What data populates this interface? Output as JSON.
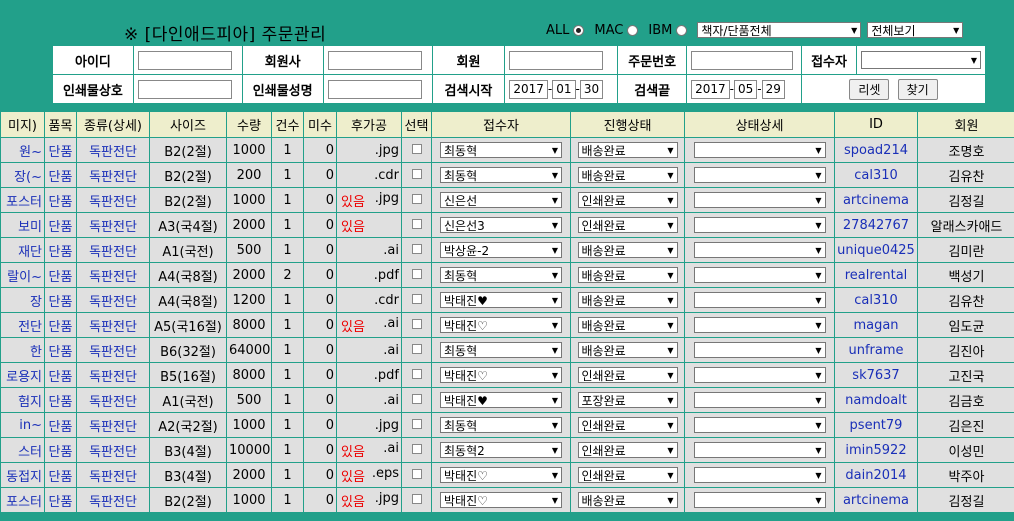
{
  "header": {
    "title": "※ [다인애드피아] 주문관리",
    "radios": [
      {
        "label": "ALL",
        "checked": true
      },
      {
        "label": "MAC",
        "checked": false
      },
      {
        "label": "IBM",
        "checked": false
      }
    ],
    "category_select": "책자/단품전체",
    "view_select": "전체보기"
  },
  "search": {
    "id_label": "아이디",
    "company_label": "회원사",
    "member_label": "회원",
    "order_no_label": "주문번호",
    "receiver_label": "접수자",
    "print_name_label": "인쇄물상호",
    "print_title_label": "인쇄물성명",
    "start_label": "검색시작",
    "end_label": "검색끝",
    "start_year": "2017",
    "start_month": "01",
    "start_day": "30",
    "end_year": "2017",
    "end_month": "05",
    "end_day": "29",
    "reset_label": "리셋",
    "find_label": "찾기"
  },
  "grid": {
    "columns": [
      "미지)",
      "품목",
      "종류(상세)",
      "사이즈",
      "수량",
      "건수",
      "미수",
      "후가공",
      "선택",
      "접수자",
      "진행상태",
      "상태상세",
      "ID",
      "회원"
    ],
    "rows": [
      {
        "name": "원~",
        "item": "단품",
        "kind": "독판전단",
        "size": "B2(2절)",
        "qty": "1000",
        "count": "1",
        "unpaid": "0",
        "post": "",
        "ext": ".jpg",
        "receiver": "최동혁",
        "status": "배송완료",
        "id": "spoad214",
        "member": "조명호"
      },
      {
        "name": "장(~",
        "item": "단품",
        "kind": "독판전단",
        "size": "B2(2절)",
        "qty": "200",
        "count": "1",
        "unpaid": "0",
        "post": "",
        "ext": ".cdr",
        "receiver": "최동혁",
        "status": "배송완료",
        "id": "cal310",
        "member": "김유찬"
      },
      {
        "name": "포스터",
        "item": "단품",
        "kind": "독판전단",
        "size": "B2(2절)",
        "qty": "1000",
        "count": "1",
        "unpaid": "0",
        "post": "있음",
        "ext": ".jpg",
        "receiver": "신은선",
        "status": "인쇄완료",
        "id": "artcinema",
        "member": "김정길"
      },
      {
        "name": "보미",
        "item": "단품",
        "kind": "독판전단",
        "size": "A3(국4절)",
        "qty": "2000",
        "count": "1",
        "unpaid": "0",
        "post": "있음",
        "ext": "",
        "receiver": "신은선3",
        "status": "인쇄완료",
        "id": "27842767",
        "member": "알래스카애드"
      },
      {
        "name": "재단",
        "item": "단품",
        "kind": "독판전단",
        "size": "A1(국전)",
        "qty": "500",
        "count": "1",
        "unpaid": "0",
        "post": "",
        "ext": ".ai",
        "receiver": "박상윤-2",
        "status": "배송완료",
        "id": "unique0425",
        "member": "김미란"
      },
      {
        "name": "랄이~",
        "item": "단품",
        "kind": "독판전단",
        "size": "A4(국8절)",
        "qty": "2000",
        "count": "2",
        "unpaid": "0",
        "post": "",
        "ext": ".pdf",
        "receiver": "최동혁",
        "status": "배송완료",
        "id": "realrental",
        "member": "백성기"
      },
      {
        "name": "장",
        "item": "단품",
        "kind": "독판전단",
        "size": "A4(국8절)",
        "qty": "1200",
        "count": "1",
        "unpaid": "0",
        "post": "",
        "ext": ".cdr",
        "receiver": "박태진♥",
        "status": "배송완료",
        "id": "cal310",
        "member": "김유찬"
      },
      {
        "name": "전단",
        "item": "단품",
        "kind": "독판전단",
        "size": "A5(국16절)",
        "qty": "8000",
        "count": "1",
        "unpaid": "0",
        "post": "있음",
        "ext": ".ai",
        "receiver": "박태진♡",
        "status": "배송완료",
        "id": "magan",
        "member": "임도균"
      },
      {
        "name": "한",
        "item": "단품",
        "kind": "독판전단",
        "size": "B6(32절)",
        "qty": "64000",
        "count": "1",
        "unpaid": "0",
        "post": "",
        "ext": ".ai",
        "receiver": "최동혁",
        "status": "배송완료",
        "id": "unframe",
        "member": "김진아"
      },
      {
        "name": "로용지",
        "item": "단품",
        "kind": "독판전단",
        "size": "B5(16절)",
        "qty": "8000",
        "count": "1",
        "unpaid": "0",
        "post": "",
        "ext": ".pdf",
        "receiver": "박태진♡",
        "status": "인쇄완료",
        "id": "sk7637",
        "member": "고진국"
      },
      {
        "name": "험지",
        "item": "단품",
        "kind": "독판전단",
        "size": "A1(국전)",
        "qty": "500",
        "count": "1",
        "unpaid": "0",
        "post": "",
        "ext": ".ai",
        "receiver": "박태진♥",
        "status": "포장완료",
        "id": "namdoalt",
        "member": "김금호"
      },
      {
        "name": "in~",
        "item": "단품",
        "kind": "독판전단",
        "size": "A2(국2절)",
        "qty": "1000",
        "count": "1",
        "unpaid": "0",
        "post": "",
        "ext": ".jpg",
        "receiver": "최동혁",
        "status": "인쇄완료",
        "id": "psent79",
        "member": "김은진"
      },
      {
        "name": "스터",
        "item": "단품",
        "kind": "독판전단",
        "size": "B3(4절)",
        "qty": "10000",
        "count": "1",
        "unpaid": "0",
        "post": "있음",
        "ext": ".ai",
        "receiver": "최동혁2",
        "status": "인쇄완료",
        "id": "imin5922",
        "member": "이성민"
      },
      {
        "name": "동접지",
        "item": "단품",
        "kind": "독판전단",
        "size": "B3(4절)",
        "qty": "2000",
        "count": "1",
        "unpaid": "0",
        "post": "있음",
        "ext": ".eps",
        "receiver": "박태진♡",
        "status": "인쇄완료",
        "id": "dain2014",
        "member": "박주아"
      },
      {
        "name": "포스터",
        "item": "단품",
        "kind": "독판전단",
        "size": "B2(2절)",
        "qty": "1000",
        "count": "1",
        "unpaid": "0",
        "post": "있음",
        "ext": ".jpg",
        "receiver": "박태진♡",
        "status": "배송완료",
        "id": "artcinema",
        "member": "김정길"
      }
    ]
  }
}
